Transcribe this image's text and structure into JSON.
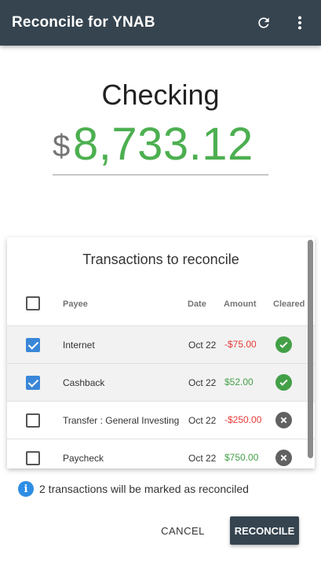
{
  "appbar": {
    "title": "Reconcile for YNAB",
    "icons": [
      "refresh-icon",
      "more-vert-icon"
    ]
  },
  "account": {
    "name": "Checking",
    "currency_symbol": "$",
    "balance": "8,733.12",
    "balance_color": "#4caf50"
  },
  "transactions": {
    "title": "Transactions to reconcile",
    "headers": {
      "payee": "Payee",
      "date": "Date",
      "amount": "Amount",
      "cleared": "Cleared"
    },
    "rows": [
      {
        "payee": "Internet",
        "date": "Oct 22",
        "amount": "-$75.00",
        "sign": "negative",
        "selected": true,
        "cleared": true
      },
      {
        "payee": "Cashback",
        "date": "Oct 22",
        "amount": "$52.00",
        "sign": "positive",
        "selected": true,
        "cleared": true
      },
      {
        "payee": "Transfer : General Investing",
        "date": "Oct 22",
        "amount": "-$250.00",
        "sign": "negative",
        "selected": false,
        "cleared": false
      },
      {
        "payee": "Paycheck",
        "date": "Oct 22",
        "amount": "$750.00",
        "sign": "positive",
        "selected": false,
        "cleared": false
      }
    ]
  },
  "info": {
    "text": "2 transactions will be marked as reconciled"
  },
  "actions": {
    "cancel": "CANCEL",
    "reconcile": "RECONCILE"
  },
  "colors": {
    "primary": "#35444f",
    "positive": "#43a047",
    "negative": "#e53935",
    "checkbox": "#3a87d8",
    "info": "#2e8de4"
  }
}
